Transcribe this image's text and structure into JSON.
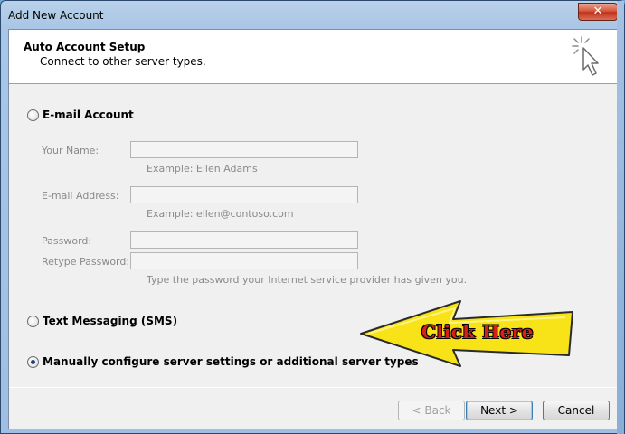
{
  "window": {
    "title": "Add New Account",
    "close_glyph": "✕"
  },
  "header": {
    "title": "Auto Account Setup",
    "subtitle": "Connect to other server types.",
    "icon": "cursor-sparkle-icon"
  },
  "options": {
    "email_account": "E-mail Account",
    "text_messaging": "Text Messaging (SMS)",
    "manual_config": "Manually configure server settings or additional server types",
    "selected": "manual_config"
  },
  "fields": {
    "your_name": {
      "label": "Your Name:",
      "value": "",
      "hint": "Example: Ellen Adams"
    },
    "email_address": {
      "label": "E-mail Address:",
      "value": "",
      "hint": "Example: ellen@contoso.com"
    },
    "password": {
      "label": "Password:",
      "value": ""
    },
    "retype_password": {
      "label": "Retype Password:",
      "value": "",
      "hint": "Type the password your Internet service provider has given you."
    }
  },
  "annotation": {
    "text": "Click Here",
    "arrow_color": "#f7e317",
    "text_color": "#d4201a"
  },
  "buttons": {
    "back": "< Back",
    "next": "Next >",
    "cancel": "Cancel"
  }
}
